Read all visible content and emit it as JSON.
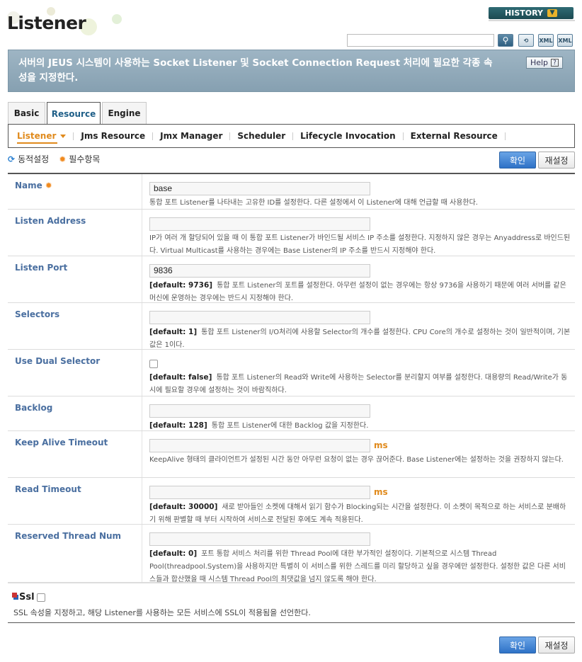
{
  "header": {
    "title": "Listener",
    "history_label": "HISTORY",
    "search_value": ""
  },
  "banner": {
    "text": "서버의 JEUS 시스템이 사용하는 Socket Listener 및 Socket Connection Request 처리에 필요한 각종 속성을 지정한다.",
    "help_label": "Help"
  },
  "tabs": [
    "Basic",
    "Resource",
    "Engine"
  ],
  "subnav": [
    "Listener",
    "Jms Resource",
    "Jmx Manager",
    "Scheduler",
    "Lifecycle Invocation",
    "External Resource"
  ],
  "legend": {
    "dynamic": "동적설정",
    "required": "필수항목"
  },
  "buttons": {
    "confirm": "확인",
    "reset": "재설정"
  },
  "fields": [
    {
      "label": "Name",
      "required": true,
      "value": "base",
      "unit": "",
      "default": "",
      "desc": "통합 포트 Listener를 나타내는 고유한 ID를 설정한다. 다른 설정에서 이 Listener에 대해 언급할 때 사용한다."
    },
    {
      "label": "Listen Address",
      "value": "",
      "unit": "",
      "default": "",
      "desc": "IP가 여러 개 할당되어 있을 때 이 통합 포트 Listener가 바인드될 서비스 IP 주소를 설정한다. 지정하지 않은 경우는 Anyaddress로 바인드된다. Virtual Multicast를 사용하는 경우에는 Base Listener의 IP 주소를 반드시 지정해야 한다."
    },
    {
      "label": "Listen Port",
      "value": "9836",
      "unit": "",
      "default": "[default: 9736]",
      "desc": "통합 포트 Listener의 포트를 설정한다. 아무런 설정이 없는 경우에는 항상 9736을 사용하기 때문에 여러 서버를 같은 머신에 운영하는 경우에는 반드시 지정해야 한다."
    },
    {
      "label": "Selectors",
      "value": "",
      "unit": "",
      "default": "[default: 1]",
      "desc": "통합 포트 Listener의 I/O처리에 사용할 Selector의 개수를 설정한다. CPU Core의 개수로 설정하는 것이 일반적이며, 기본값은 1이다."
    },
    {
      "label": "Use Dual Selector",
      "checkbox": true,
      "default": "[default: false]",
      "desc": "통합 포트 Listener의 Read와 Write에 사용하는 Selector를 분리할지 여부를 설정한다. 대용량의 Read/Write가 동시에 필요할 경우에 설정하는 것이 바람직하다."
    },
    {
      "label": "Backlog",
      "value": "",
      "unit": "",
      "default": "[default: 128]",
      "desc": "통합 포트 Listener에 대한 Backlog 값을 지정한다."
    },
    {
      "label": "Keep Alive Timeout",
      "value": "",
      "unit": "ms",
      "default": "",
      "desc": "KeepAlive 형태의 클라이언트가 설정된 시간 동안 아무런 요청이 없는 경우 끊어준다. Base Listener에는 설정하는 것을 권장하지 않는다."
    },
    {
      "label": "Read Timeout",
      "value": "",
      "unit": "ms",
      "default": "[default: 30000]",
      "desc": "새로 받아들인 소켓에 대해서 읽기 함수가 Blocking되는 시간을 설정한다. 이 소켓이 목적으로 하는 서비스로 분배하기 위해 판별할 때 부터 시작하여 서비스로 전달된 후에도 계속 적용된다."
    },
    {
      "label": "Reserved Thread Num",
      "value": "",
      "unit": "",
      "default": "[default: 0]",
      "desc": "포트 통합 서비스 처리를 위한 Thread Pool에 대한 부가적인 설정이다. 기본적으로 시스템 Thread Pool(threadpool.System)을 사용하지만 특별히 이 서비스를 위한 스레드를 미리 할당하고 싶을 경우에만 설정한다. 설정한 값은 다른 서비스들과 합산했을 때 시스템 Thread Pool의 최댓값을 넘지 않도록 해야 한다."
    }
  ],
  "ssl": {
    "label": "Ssl",
    "desc": "SSL 속성을 지정하고, 해당 Listener를 사용하는 모든 서비스에 SSL이 적용됨을 선언한다."
  }
}
